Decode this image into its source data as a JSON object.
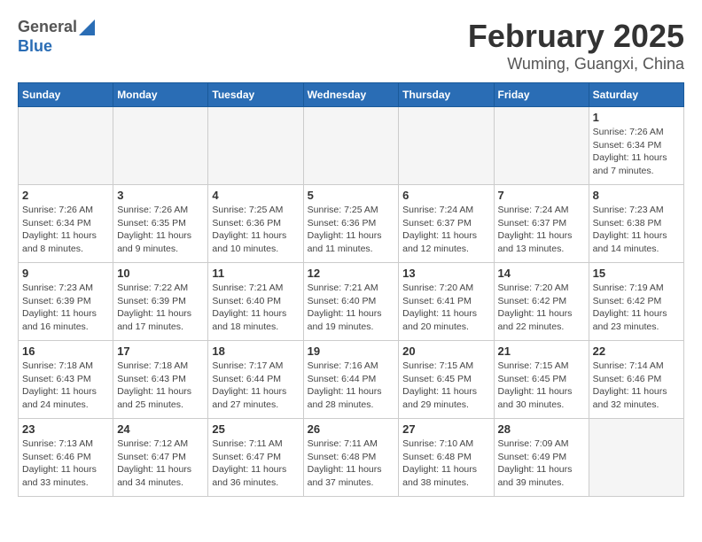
{
  "logo": {
    "line1": "General",
    "line2": "Blue"
  },
  "title": "February 2025",
  "subtitle": "Wuming, Guangxi, China",
  "days_of_week": [
    "Sunday",
    "Monday",
    "Tuesday",
    "Wednesday",
    "Thursday",
    "Friday",
    "Saturday"
  ],
  "weeks": [
    [
      {
        "day": "",
        "info": ""
      },
      {
        "day": "",
        "info": ""
      },
      {
        "day": "",
        "info": ""
      },
      {
        "day": "",
        "info": ""
      },
      {
        "day": "",
        "info": ""
      },
      {
        "day": "",
        "info": ""
      },
      {
        "day": "1",
        "info": "Sunrise: 7:26 AM\nSunset: 6:34 PM\nDaylight: 11 hours and 7 minutes."
      }
    ],
    [
      {
        "day": "2",
        "info": "Sunrise: 7:26 AM\nSunset: 6:34 PM\nDaylight: 11 hours and 8 minutes."
      },
      {
        "day": "3",
        "info": "Sunrise: 7:26 AM\nSunset: 6:35 PM\nDaylight: 11 hours and 9 minutes."
      },
      {
        "day": "4",
        "info": "Sunrise: 7:25 AM\nSunset: 6:36 PM\nDaylight: 11 hours and 10 minutes."
      },
      {
        "day": "5",
        "info": "Sunrise: 7:25 AM\nSunset: 6:36 PM\nDaylight: 11 hours and 11 minutes."
      },
      {
        "day": "6",
        "info": "Sunrise: 7:24 AM\nSunset: 6:37 PM\nDaylight: 11 hours and 12 minutes."
      },
      {
        "day": "7",
        "info": "Sunrise: 7:24 AM\nSunset: 6:37 PM\nDaylight: 11 hours and 13 minutes."
      },
      {
        "day": "8",
        "info": "Sunrise: 7:23 AM\nSunset: 6:38 PM\nDaylight: 11 hours and 14 minutes."
      }
    ],
    [
      {
        "day": "9",
        "info": "Sunrise: 7:23 AM\nSunset: 6:39 PM\nDaylight: 11 hours and 16 minutes."
      },
      {
        "day": "10",
        "info": "Sunrise: 7:22 AM\nSunset: 6:39 PM\nDaylight: 11 hours and 17 minutes."
      },
      {
        "day": "11",
        "info": "Sunrise: 7:21 AM\nSunset: 6:40 PM\nDaylight: 11 hours and 18 minutes."
      },
      {
        "day": "12",
        "info": "Sunrise: 7:21 AM\nSunset: 6:40 PM\nDaylight: 11 hours and 19 minutes."
      },
      {
        "day": "13",
        "info": "Sunrise: 7:20 AM\nSunset: 6:41 PM\nDaylight: 11 hours and 20 minutes."
      },
      {
        "day": "14",
        "info": "Sunrise: 7:20 AM\nSunset: 6:42 PM\nDaylight: 11 hours and 22 minutes."
      },
      {
        "day": "15",
        "info": "Sunrise: 7:19 AM\nSunset: 6:42 PM\nDaylight: 11 hours and 23 minutes."
      }
    ],
    [
      {
        "day": "16",
        "info": "Sunrise: 7:18 AM\nSunset: 6:43 PM\nDaylight: 11 hours and 24 minutes."
      },
      {
        "day": "17",
        "info": "Sunrise: 7:18 AM\nSunset: 6:43 PM\nDaylight: 11 hours and 25 minutes."
      },
      {
        "day": "18",
        "info": "Sunrise: 7:17 AM\nSunset: 6:44 PM\nDaylight: 11 hours and 27 minutes."
      },
      {
        "day": "19",
        "info": "Sunrise: 7:16 AM\nSunset: 6:44 PM\nDaylight: 11 hours and 28 minutes."
      },
      {
        "day": "20",
        "info": "Sunrise: 7:15 AM\nSunset: 6:45 PM\nDaylight: 11 hours and 29 minutes."
      },
      {
        "day": "21",
        "info": "Sunrise: 7:15 AM\nSunset: 6:45 PM\nDaylight: 11 hours and 30 minutes."
      },
      {
        "day": "22",
        "info": "Sunrise: 7:14 AM\nSunset: 6:46 PM\nDaylight: 11 hours and 32 minutes."
      }
    ],
    [
      {
        "day": "23",
        "info": "Sunrise: 7:13 AM\nSunset: 6:46 PM\nDaylight: 11 hours and 33 minutes."
      },
      {
        "day": "24",
        "info": "Sunrise: 7:12 AM\nSunset: 6:47 PM\nDaylight: 11 hours and 34 minutes."
      },
      {
        "day": "25",
        "info": "Sunrise: 7:11 AM\nSunset: 6:47 PM\nDaylight: 11 hours and 36 minutes."
      },
      {
        "day": "26",
        "info": "Sunrise: 7:11 AM\nSunset: 6:48 PM\nDaylight: 11 hours and 37 minutes."
      },
      {
        "day": "27",
        "info": "Sunrise: 7:10 AM\nSunset: 6:48 PM\nDaylight: 11 hours and 38 minutes."
      },
      {
        "day": "28",
        "info": "Sunrise: 7:09 AM\nSunset: 6:49 PM\nDaylight: 11 hours and 39 minutes."
      },
      {
        "day": "",
        "info": ""
      }
    ]
  ]
}
